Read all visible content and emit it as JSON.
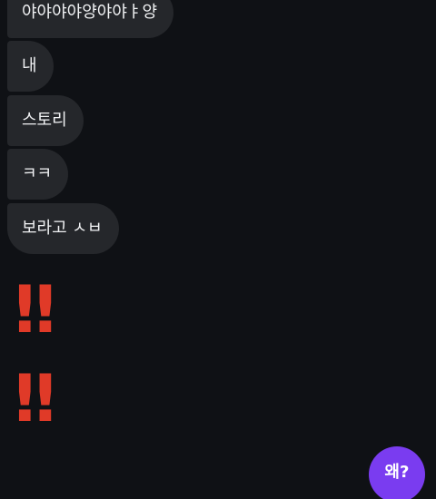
{
  "messages": [
    {
      "text": "야야야야양야야ㅑ양"
    },
    {
      "text": "내"
    },
    {
      "text": "스토리"
    },
    {
      "text": "ㅋㅋ"
    },
    {
      "text": "보라고 ㅅㅂ"
    }
  ],
  "emoji": {
    "first": "‼",
    "second": "‼"
  },
  "reply_button": {
    "label": "왜?"
  },
  "colors": {
    "background": "#0f1115",
    "bubble": "#25272b",
    "emoji": "#e03a28",
    "accent": "#7a3cf0"
  }
}
